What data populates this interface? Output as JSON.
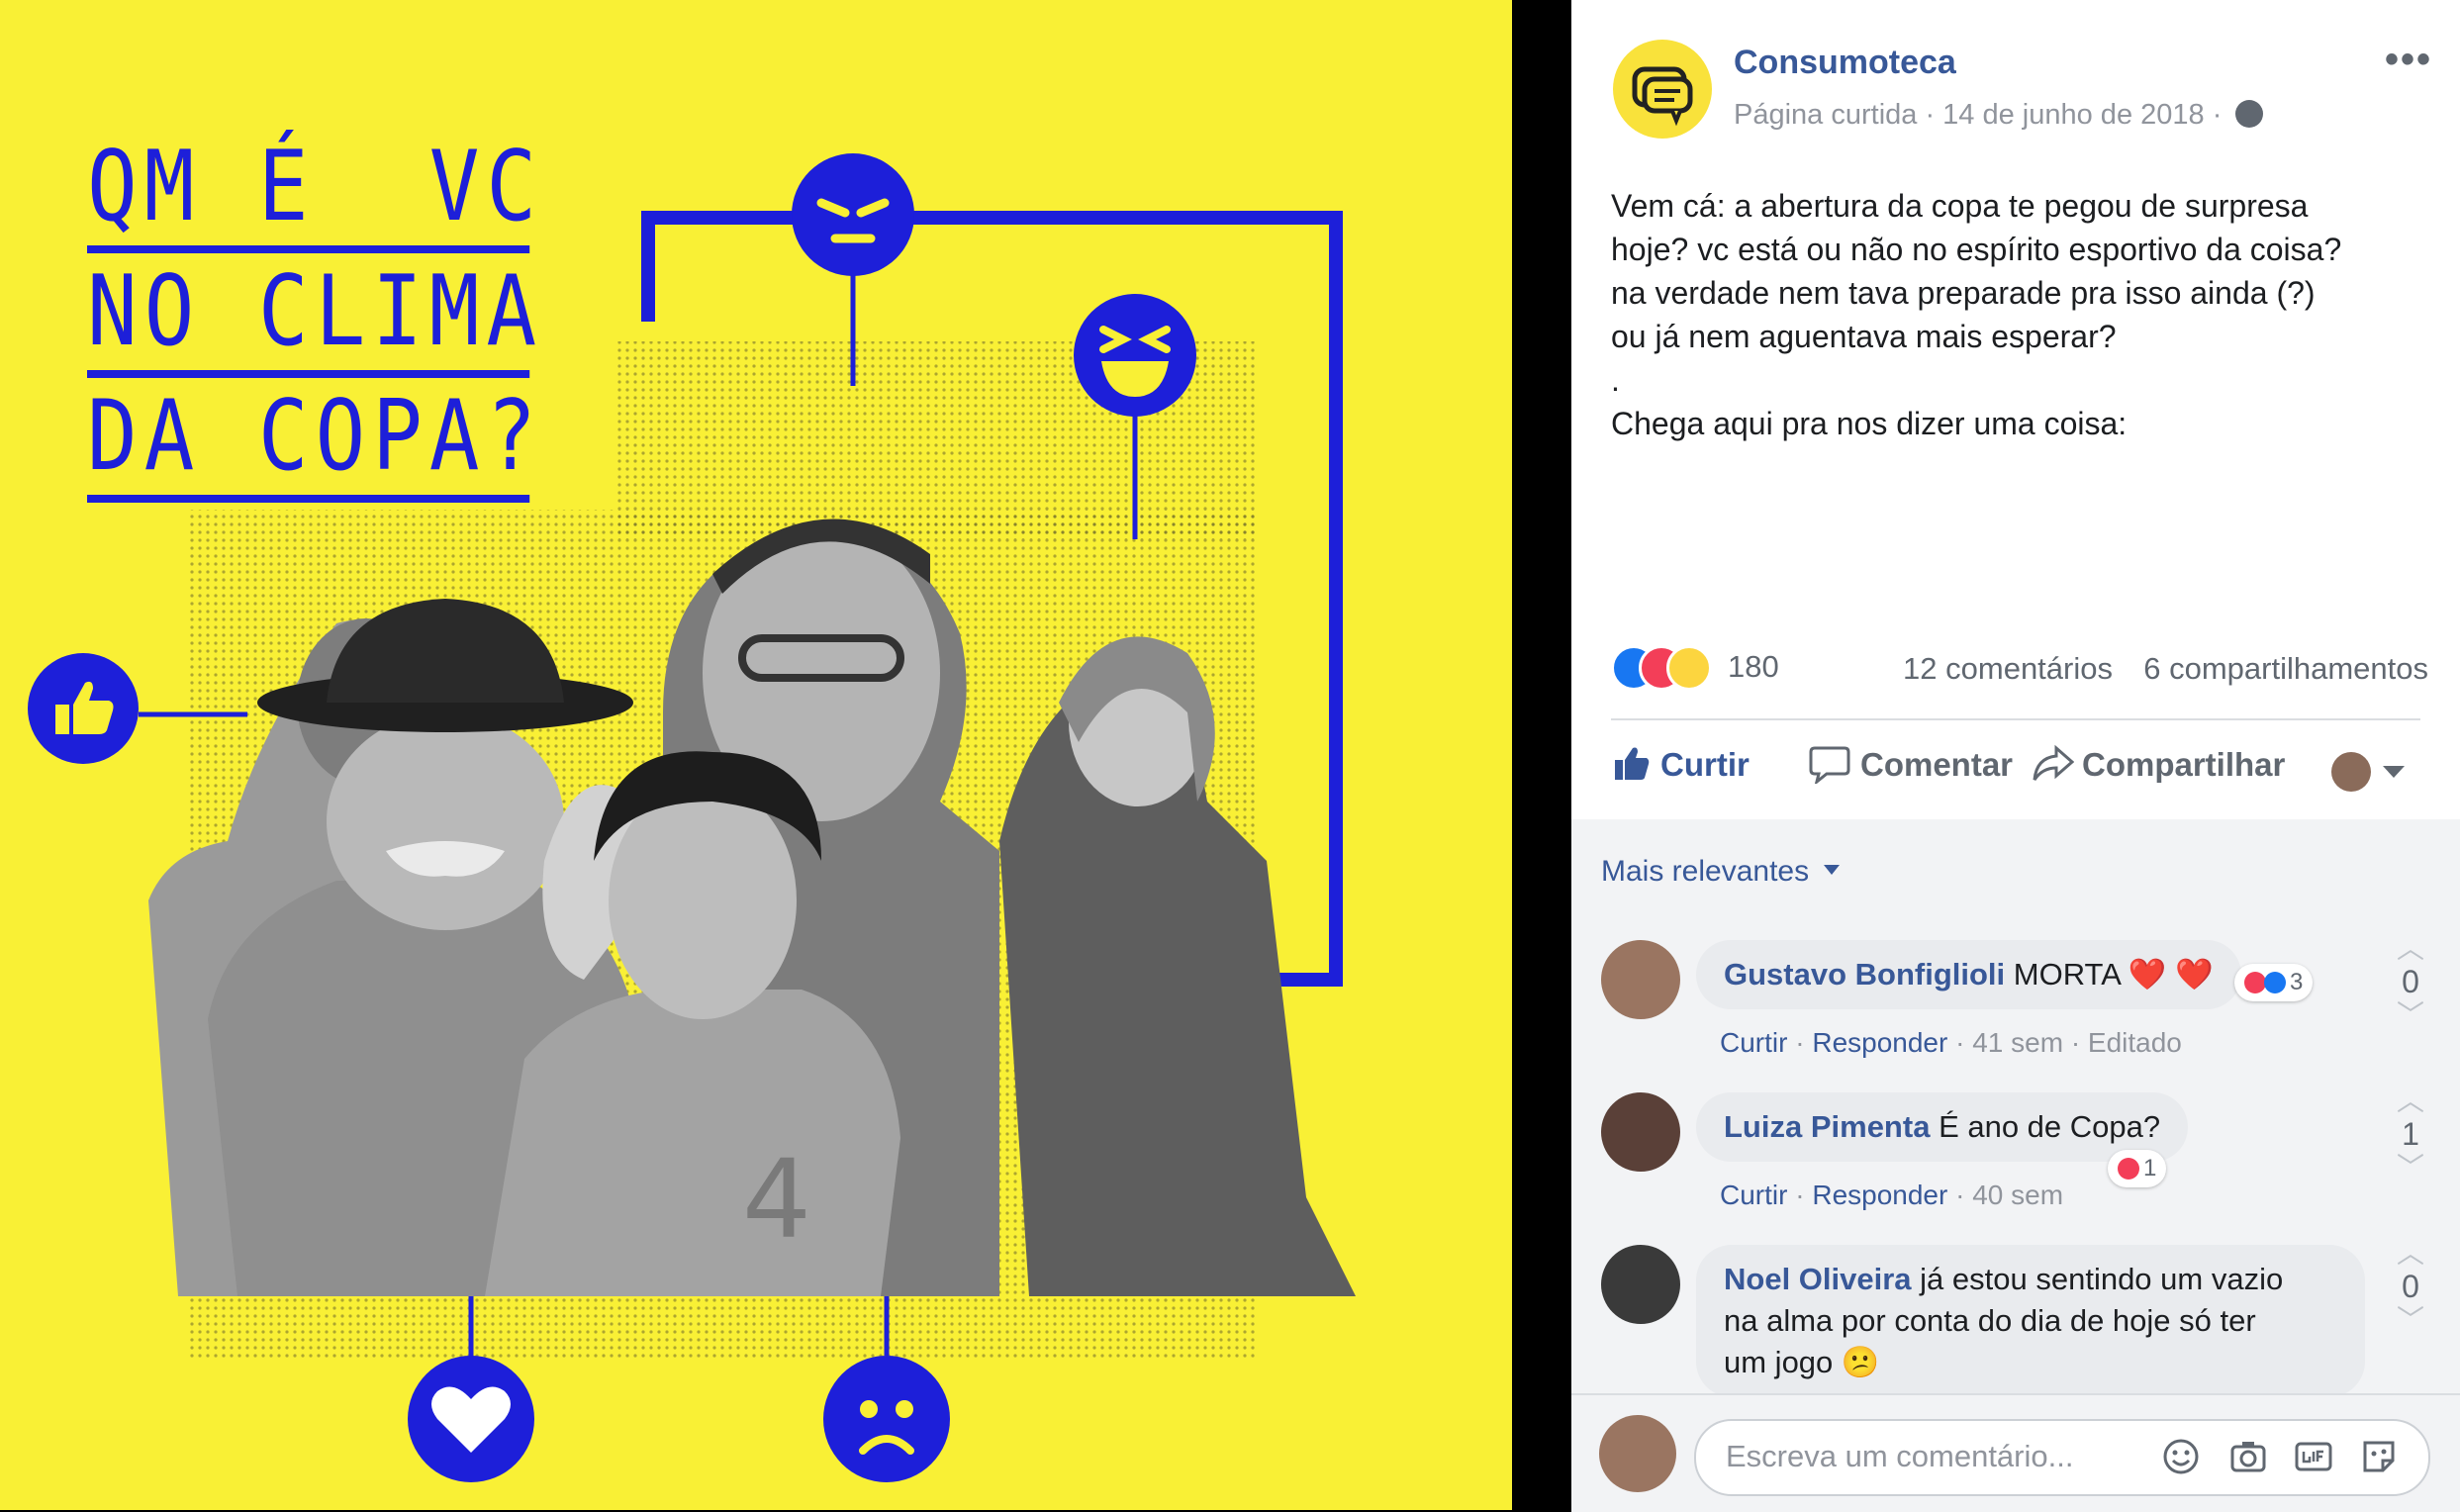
{
  "image": {
    "title_lines": [
      "QM É  VC",
      "NO CLIMA",
      "DA COPA?"
    ],
    "emoji_icons": [
      "angry-face-icon",
      "laughing-face-icon",
      "thumbs-up-icon",
      "heart-icon",
      "sad-face-icon"
    ],
    "colors": {
      "background": "#f9f035",
      "accent": "#1d1fd9"
    }
  },
  "post": {
    "page_name": "Consumoteca",
    "meta": "Página curtida · 14 de junho de 2018 ·",
    "more_label": "•••",
    "text_lines": [
      "Vem cá: a abertura da copa te pegou de surpresa",
      "hoje? vc está ou não no espírito esportivo da coisa?",
      "na verdade nem tava preparade pra isso ainda (?)",
      "ou já nem aguentava mais esperar?",
      ".",
      "Chega aqui pra nos dizer uma coisa:"
    ],
    "reactions_count": "180",
    "comments_count": "12 comentários",
    "shares_count": "6 compartilhamentos"
  },
  "actions": {
    "like": "Curtir",
    "comment": "Comentar",
    "share": "Compartilhar"
  },
  "comments": {
    "sort_label": "Mais relevantes",
    "items": [
      {
        "name": "Gustavo Bonfiglioli",
        "text": "MORTA ❤️ ❤️",
        "reply": "Curtir",
        "answer": "Responder",
        "meta": " · 41 sem · Editado",
        "reaction_count": "3",
        "vote": "0"
      },
      {
        "name": "Luiza Pimenta",
        "text": "É ano de Copa?",
        "reply": "Curtir",
        "answer": "Responder",
        "meta": " · 40 sem",
        "reaction_count": "1",
        "vote": "1"
      },
      {
        "name": "Noel Oliveira",
        "text_lines": [
          "já estou sentindo um vazio",
          "na alma por conta do dia de hoje só ter",
          "um jogo 😕"
        ],
        "vote": "0"
      }
    ],
    "composer_placeholder": "Escreva um comentário..."
  }
}
